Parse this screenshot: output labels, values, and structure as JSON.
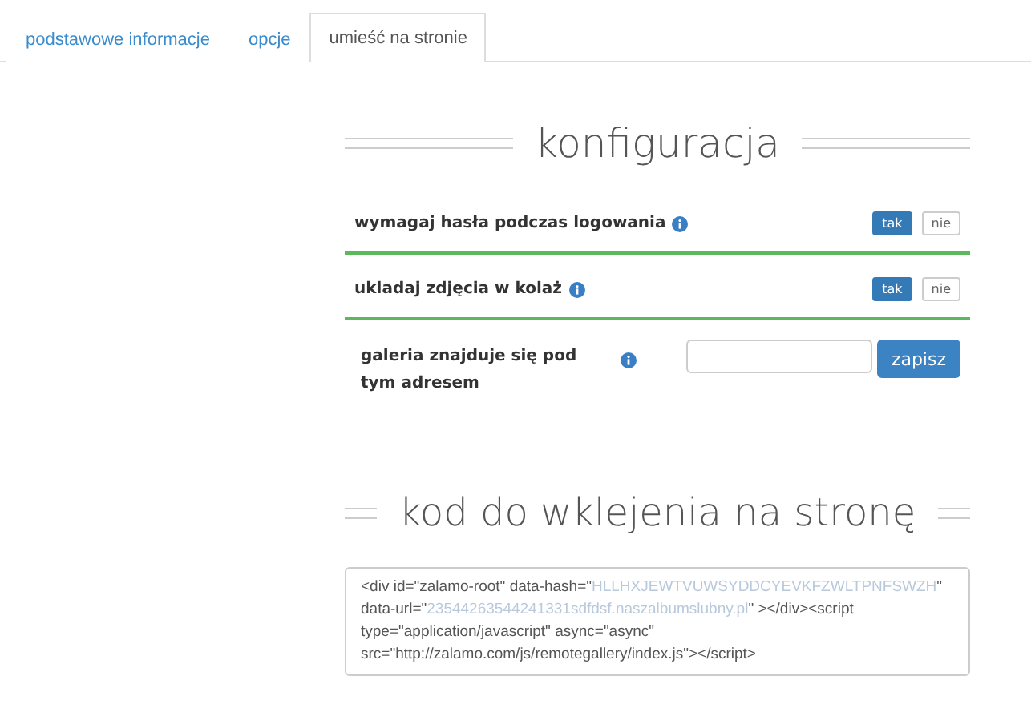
{
  "tabs": [
    {
      "label": "podstawowe informacje",
      "selected": false
    },
    {
      "label": "opcje",
      "selected": false
    },
    {
      "label": "umieść na stronie",
      "selected": true
    }
  ],
  "config": {
    "heading": "konfiguracja",
    "rows": [
      {
        "kind": "toggle",
        "label": "wymagaj hasła podczas logowania",
        "options": [
          {
            "label": "tak",
            "selected": true
          },
          {
            "label": "nie",
            "selected": false
          }
        ]
      },
      {
        "kind": "toggle",
        "label": "ukladaj zdjęcia w kolaż",
        "options": [
          {
            "label": "tak",
            "selected": true
          },
          {
            "label": "nie",
            "selected": false
          }
        ]
      },
      {
        "kind": "address",
        "label": "galeria znajduje się pod tym adresem",
        "button": "zapisz"
      }
    ]
  },
  "embed": {
    "heading": "kod do wklejenia na stronę",
    "code": [
      {
        "kind": "code",
        "text": "<div id=\"zalamo-root\"  data-hash=\""
      },
      {
        "kind": "value",
        "text": "HLLHXJEWTVUWSYDDCYEVKFZWLTPNFSWZH"
      },
      {
        "kind": "code",
        "text": "\" data-url=\""
      },
      {
        "kind": "value",
        "text": "23544263544241331sdfdsf.naszalbumslubny.pl"
      },
      {
        "kind": "code",
        "text": "\" ></div><script type=\"application/javascript\" async=\"async\" src=\"http://zalamo.com/js/remotegallery/index.js\"></script>"
      }
    ]
  }
}
